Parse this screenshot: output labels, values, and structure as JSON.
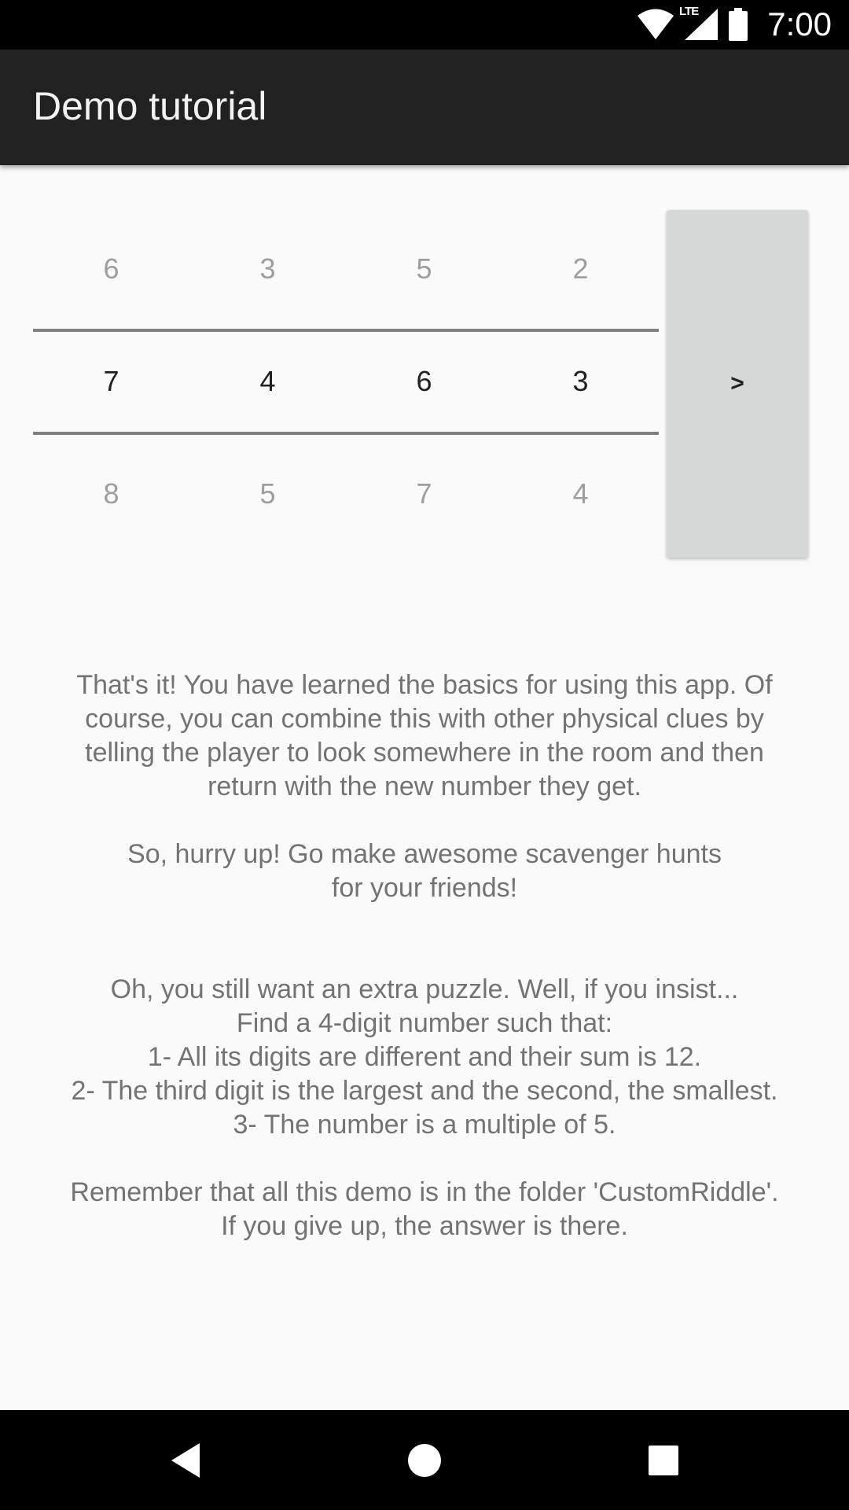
{
  "status_bar": {
    "time": "7:00",
    "network_label": "LTE",
    "icons": [
      "wifi-icon",
      "cellular-signal-icon",
      "battery-icon"
    ]
  },
  "app_bar": {
    "title": "Demo tutorial"
  },
  "picker": {
    "columns": [
      {
        "above": "6",
        "selected": "7",
        "below": "8"
      },
      {
        "above": "3",
        "selected": "4",
        "below": "5"
      },
      {
        "above": "5",
        "selected": "6",
        "below": "7"
      },
      {
        "above": "2",
        "selected": "3",
        "below": "4"
      }
    ]
  },
  "next_button": {
    "label": ">"
  },
  "message": {
    "intro": [
      "That's it! You have learned the basics for using this app. Of",
      "course, you can combine this with other physical clues by",
      "telling the player to look somewhere in the room and then",
      "return with the new number they get."
    ],
    "hurry": [
      "So, hurry up! Go make awesome scavenger hunts",
      "for your friends!"
    ],
    "puzzle": [
      "Oh, you still want an extra puzzle. Well, if you insist...",
      "Find a 4-digit number such that:",
      "1- All its digits are different and their sum is 12.",
      "2- The third digit is the largest and the second, the smallest.",
      "3- The number is a multiple of 5."
    ],
    "footer": [
      "Remember that all this demo is in the folder 'CustomRiddle'.",
      "If you give up, the answer is there."
    ]
  },
  "nav_bar": {
    "icons": [
      "back-icon",
      "home-icon",
      "recents-icon"
    ]
  },
  "colors": {
    "status_bar": "#000000",
    "app_bar": "#212121",
    "background": "#fafafa",
    "button": "#d6d7d7",
    "text_dim": "#9e9e9e",
    "text_message": "#737373"
  }
}
